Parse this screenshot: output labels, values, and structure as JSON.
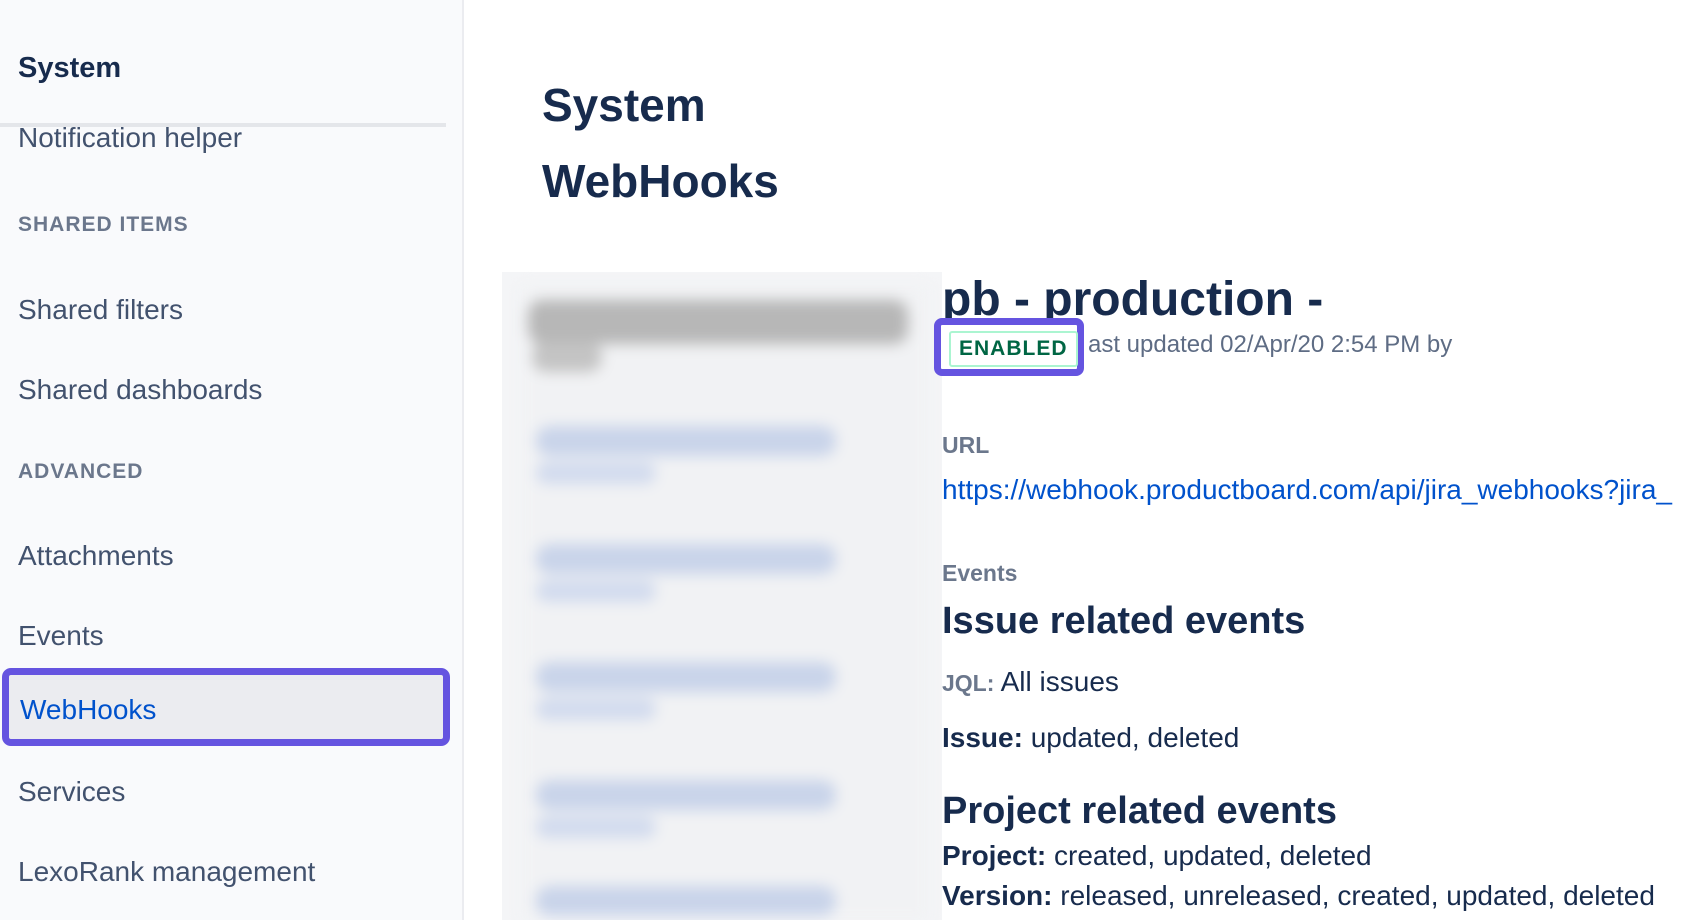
{
  "sidebar": {
    "section_title": "System",
    "items_top": [
      "Notification helper"
    ],
    "shared_heading": "SHARED ITEMS",
    "shared_items": [
      "Shared filters",
      "Shared dashboards"
    ],
    "advanced_heading": "ADVANCED",
    "advanced_items": [
      "Attachments",
      "Events"
    ],
    "active_item": "WebHooks",
    "after_items": [
      "Services",
      "LexoRank management"
    ]
  },
  "page": {
    "title_line1": "System",
    "title_line2": "WebHooks"
  },
  "webhook": {
    "name": "pb - production -",
    "status": "ENABLED",
    "last_updated": "ast updated 02/Apr/20 2:54 PM by",
    "url_label": "URL",
    "url": "https://webhook.productboard.com/api/jira_webhooks?jira_",
    "events_label": "Events",
    "issue_heading": "Issue related events",
    "jql_label": "JQL:",
    "jql_value": "All issues",
    "issue_label": "Issue:",
    "issue_value": "updated, deleted",
    "project_heading": "Project related events",
    "project_label": "Project:",
    "project_value": "created, updated, deleted",
    "version_label": "Version:",
    "version_value": "released, unreleased, created, updated, deleted"
  },
  "colors": {
    "highlight": "#6554e0",
    "link": "#0052cc",
    "enabled_green": "#006644"
  }
}
